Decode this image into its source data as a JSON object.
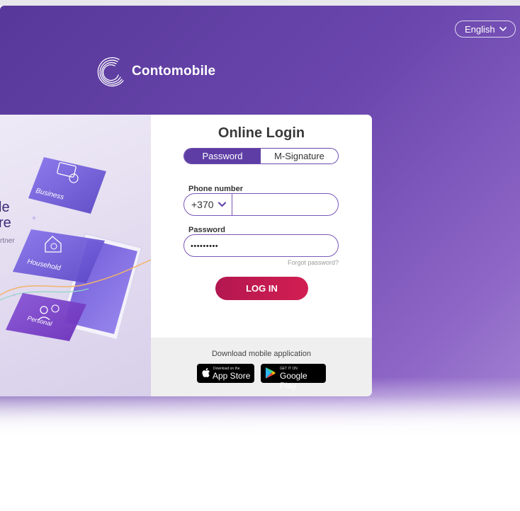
{
  "header": {
    "language": "English",
    "brand": "Contomobile"
  },
  "promo": {
    "line1": "le",
    "line2": "re",
    "line3": "rtner",
    "cards": [
      "Business",
      "Household",
      "Personal"
    ]
  },
  "login": {
    "title": "Online Login",
    "tabs": [
      "Password",
      "M-Signature"
    ],
    "active_tab": "Password",
    "phone_label": "Phone number",
    "country_code": "+370",
    "phone_value": "",
    "password_label": "Password",
    "password_value": "passwords",
    "forgot": "Forgot password?",
    "submit": "LOG IN"
  },
  "download": {
    "label": "Download mobile application",
    "app_store_small": "Download on the",
    "app_store_big": "App Store",
    "google_small": "GET IT ON",
    "google_big": "Google Play"
  },
  "colors": {
    "brand_purple": "#5e3ea5",
    "accent_red": "#c81a50",
    "hero_start": "#57389a",
    "hero_end": "#a687d4"
  },
  "icons": [
    "chevron-down-icon",
    "brand-logo-icon",
    "apple-icon",
    "google-play-icon",
    "briefcase-euro-icon",
    "house-euro-icon",
    "person-euro-icon"
  ]
}
